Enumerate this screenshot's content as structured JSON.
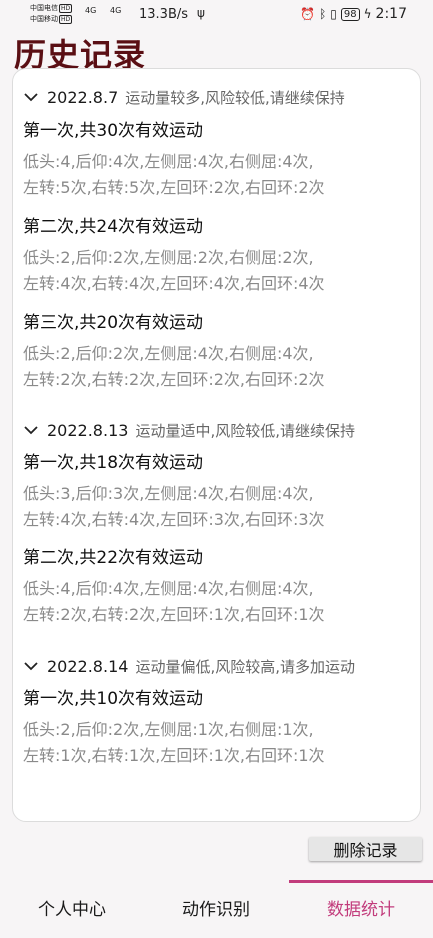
{
  "status_bar": {
    "carrier1": "中国电信",
    "carrier2": "中国移动",
    "hd": "HD",
    "net1": "4G",
    "net2": "4G",
    "speed": "13.3B/s",
    "battery": "98",
    "time": "2:17"
  },
  "page_title": "历史记录",
  "groups": [
    {
      "date": "2022.8.7",
      "status": "运动量较多,风险较低,请继续保持",
      "sessions": [
        {
          "title": "第一次,共30次有效运动",
          "line1": "低头:4,后仰:4次,左侧屈:4次,右侧屈:4次,",
          "line2": "左转:5次,右转:5次,左回环:2次,右回环:2次"
        },
        {
          "title": "第二次,共24次有效运动",
          "line1": "低头:2,后仰:2次,左侧屈:2次,右侧屈:2次,",
          "line2": "左转:4次,右转:4次,左回环:4次,右回环:4次"
        },
        {
          "title": "第三次,共20次有效运动",
          "line1": "低头:2,后仰:2次,左侧屈:4次,右侧屈:4次,",
          "line2": "左转:2次,右转:2次,左回环:2次,右回环:2次"
        }
      ]
    },
    {
      "date": "2022.8.13",
      "status": "运动量适中,风险较低,请继续保持",
      "sessions": [
        {
          "title": "第一次,共18次有效运动",
          "line1": "低头:3,后仰:3次,左侧屈:4次,右侧屈:4次,",
          "line2": "左转:4次,右转:4次,左回环:3次,右回环:3次"
        },
        {
          "title": "第二次,共22次有效运动",
          "line1": "低头:4,后仰:4次,左侧屈:4次,右侧屈:4次,",
          "line2": "左转:2次,右转:2次,左回环:1次,右回环:1次"
        }
      ]
    },
    {
      "date": "2022.8.14",
      "status": "运动量偏低,风险较高,请多加运动",
      "sessions": [
        {
          "title": "第一次,共10次有效运动",
          "line1": "低头:2,后仰:2次,左侧屈:1次,右侧屈:1次,",
          "line2": "左转:1次,右转:1次,左回环:1次,右回环:1次"
        }
      ]
    }
  ],
  "delete_button": "删除记录",
  "tabs": [
    {
      "label": "个人中心",
      "active": false
    },
    {
      "label": "动作识别",
      "active": false
    },
    {
      "label": "数据统计",
      "active": true
    }
  ],
  "colors": {
    "title": "#5a0f14",
    "accent": "#c23c7c"
  }
}
